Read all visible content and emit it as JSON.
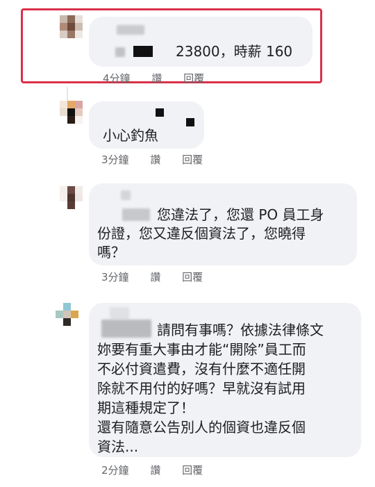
{
  "comments": [
    {
      "text_suffix": "23800，時薪 160",
      "time": "4分鐘",
      "like_label": "讚",
      "reply_label": "回覆"
    },
    {
      "text": "小心釣魚",
      "time": "3分鐘",
      "like_label": "讚",
      "reply_label": "回覆"
    },
    {
      "text": "您違法了，您還 PO 員工身份證，您又違反個資法了，您曉得嗎？",
      "line1": "您違法了，您還 PO 員工身",
      "line2": "份證，您又違反個資法了，您曉得",
      "line3": "嗎？",
      "time": "3分鐘",
      "like_label": "讚",
      "reply_label": "回覆"
    },
    {
      "line1": "請問有事嗎？依據法律條文",
      "line2": "妳要有重大事由才能“開除”員工而",
      "line3": "不必付資遣費，沒有什麼不適任開",
      "line4": "除就不用付的好嗎？早就沒有試用",
      "line5": "期這種規定了！",
      "line6": "還有隨意公告別人的個資也違反個",
      "line7": "資法...",
      "time": "2分鐘",
      "like_label": "讚",
      "reply_label": "回覆"
    }
  ],
  "colors": {
    "highlight": "#d9304a",
    "bubble": "#f0f2f5",
    "meta_text": "#65676b"
  }
}
